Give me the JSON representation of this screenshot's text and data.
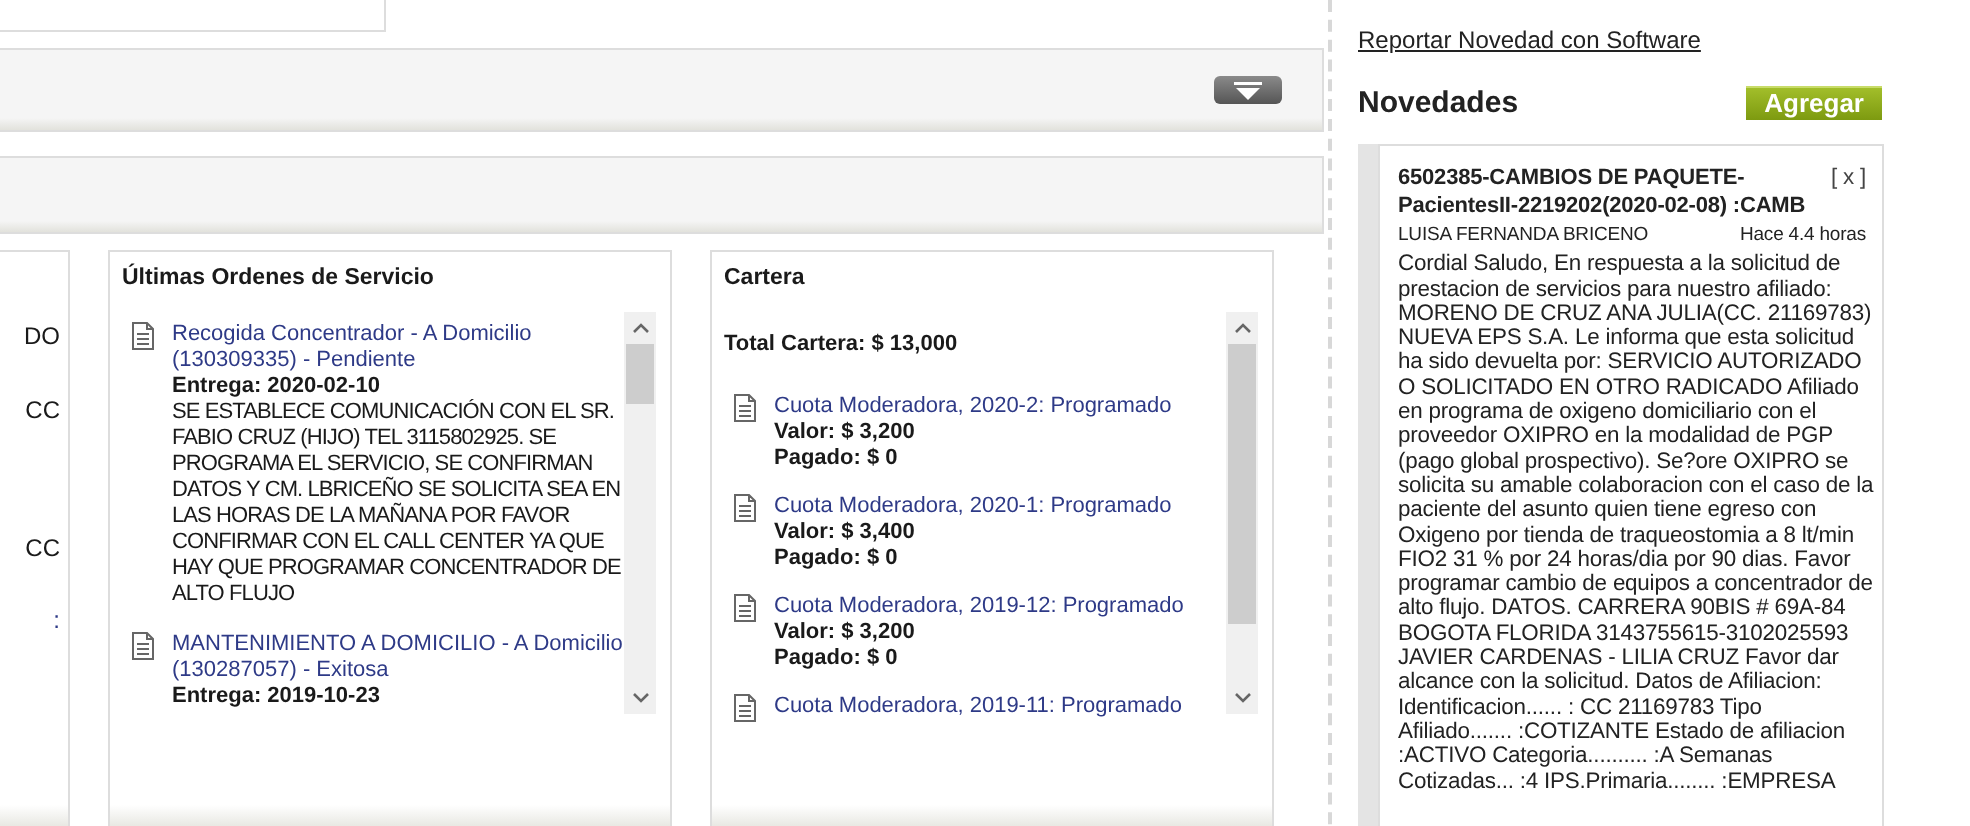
{
  "left_panel": {
    "fragments": [
      "DO",
      "CC",
      "CC",
      ":"
    ]
  },
  "ordenes": {
    "title": "Últimas Ordenes de Servicio",
    "items": [
      {
        "link": "Recogida Concentrador - A Domicilio (130309335) - Pendiente",
        "delivery": "Entrega: 2020-02-10",
        "detail": "SE ESTABLECE COMUNICACIÓN CON EL SR. FABIO CRUZ (HIJO) TEL 3115802925. SE PROGRAMA EL SERVICIO, SE CONFIRMAN DATOS Y CM. LBRICEÑO SE SOLICITA SEA EN LAS HORAS DE LA MAÑANA POR FAVOR CONFIRMAR CON EL CALL CENTER YA QUE HAY QUE PROGRAMAR CONCENTRADOR DE ALTO FLUJO"
      },
      {
        "link": "MANTENIMIENTO A DOMICILIO - A Domicilio (130287057) - Exitosa",
        "delivery": "Entrega: 2019-10-23"
      }
    ]
  },
  "cartera": {
    "title": "Cartera",
    "total": "Total Cartera: $ 13,000",
    "items": [
      {
        "link": "Cuota Moderadora, 2020-2: Programado",
        "value": "Valor: $ 3,200",
        "paid": "Pagado: $ 0"
      },
      {
        "link": "Cuota Moderadora, 2020-1: Programado",
        "value": "Valor: $ 3,400",
        "paid": "Pagado: $ 0"
      },
      {
        "link": "Cuota Moderadora, 2019-12: Programado",
        "value": "Valor: $ 3,200",
        "paid": "Pagado: $ 0"
      },
      {
        "link": "Cuota Moderadora, 2019-11: Programado"
      }
    ]
  },
  "sidebar": {
    "links": [
      "Reportar Novedad con Software"
    ],
    "novedades": {
      "title": "Novedades",
      "add_button": "Agregar",
      "items": [
        {
          "title": "6502385-CAMBIOS DE PAQUETE-PacientesII-2219202(2020-02-08) :CAMB",
          "close": "[ x ]",
          "author": "LUISA FERNANDA BRICENO",
          "time": "Hace 4.4 horas",
          "body": "Cordial Saludo, En respuesta a la solicitud de prestacion de servicios para nuestro afiliado: MORENO DE CRUZ ANA JULIA(CC. 21169783) NUEVA EPS S.A. Le informa que esta solicitud ha sido devuelta por: SERVICIO AUTORIZADO O SOLICITADO EN OTRO RADICADO Afiliado en programa de oxigeno domiciliario con el proveedor OXIPRO en la modalidad de PGP (pago global prospectivo). Se?ore OXIPRO se solicita su amable colaboracion con el caso de la paciente del asunto quien tiene egreso con Oxigeno por tienda de traqueostomia a 8 lt/min FIO2 31 % por 24 horas/dia por 90 dias. Favor programar cambio de equipos a concentrador de alto flujo. DATOS. CARRERA 90BIS # 69A-84 BOGOTA FLORIDA 3143755615-3102025593 JAVIER CARDENAS - LILIA CRUZ Favor dar alcance con la solicitud. Datos de Afiliacion: Identificacion...... : CC 21169783 Tipo Afiliado....... :COTIZANTE Estado de afiliacion :ACTIVO Categoria.......... :A Semanas Cotizadas... :4 IPS.Primaria........ :EMPRESA"
        }
      ]
    }
  }
}
